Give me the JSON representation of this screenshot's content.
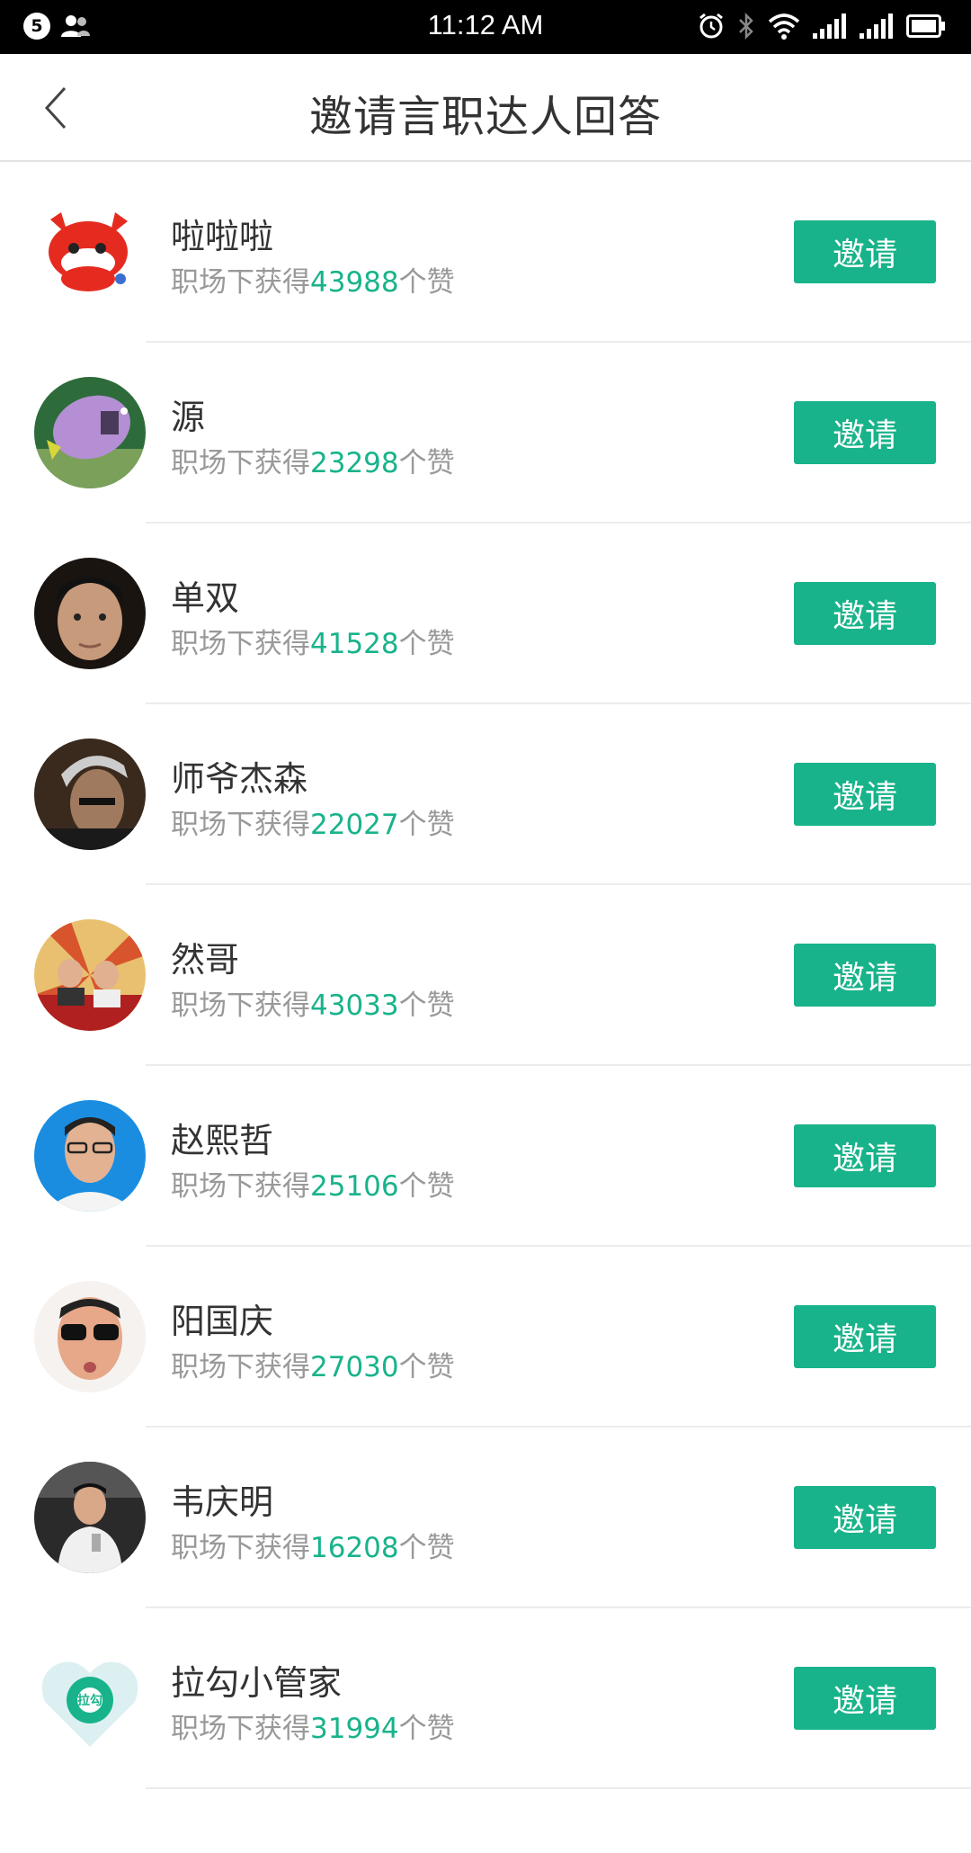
{
  "status_bar": {
    "notification_count": "5",
    "time": "11:12 AM",
    "sim2_label": "2"
  },
  "header": {
    "title": "邀请言职达人回答",
    "back_icon": "chevron-left-icon"
  },
  "stat_prefix": "职场下获得",
  "stat_suffix": "个赞",
  "invite_label": "邀请",
  "accent_color": "#18b38a",
  "users": [
    {
      "name": "啦啦啦",
      "likes": "43988"
    },
    {
      "name": "源",
      "likes": "23298"
    },
    {
      "name": "单双",
      "likes": "41528"
    },
    {
      "name": "师爷杰森",
      "likes": "22027"
    },
    {
      "name": "然哥",
      "likes": "43033"
    },
    {
      "name": "赵熙哲",
      "likes": "25106"
    },
    {
      "name": "阳国庆",
      "likes": "27030"
    },
    {
      "name": "韦庆明",
      "likes": "16208"
    },
    {
      "name": "拉勾小管家",
      "likes": "31994"
    }
  ],
  "lagou_logo_text": "拉勾"
}
